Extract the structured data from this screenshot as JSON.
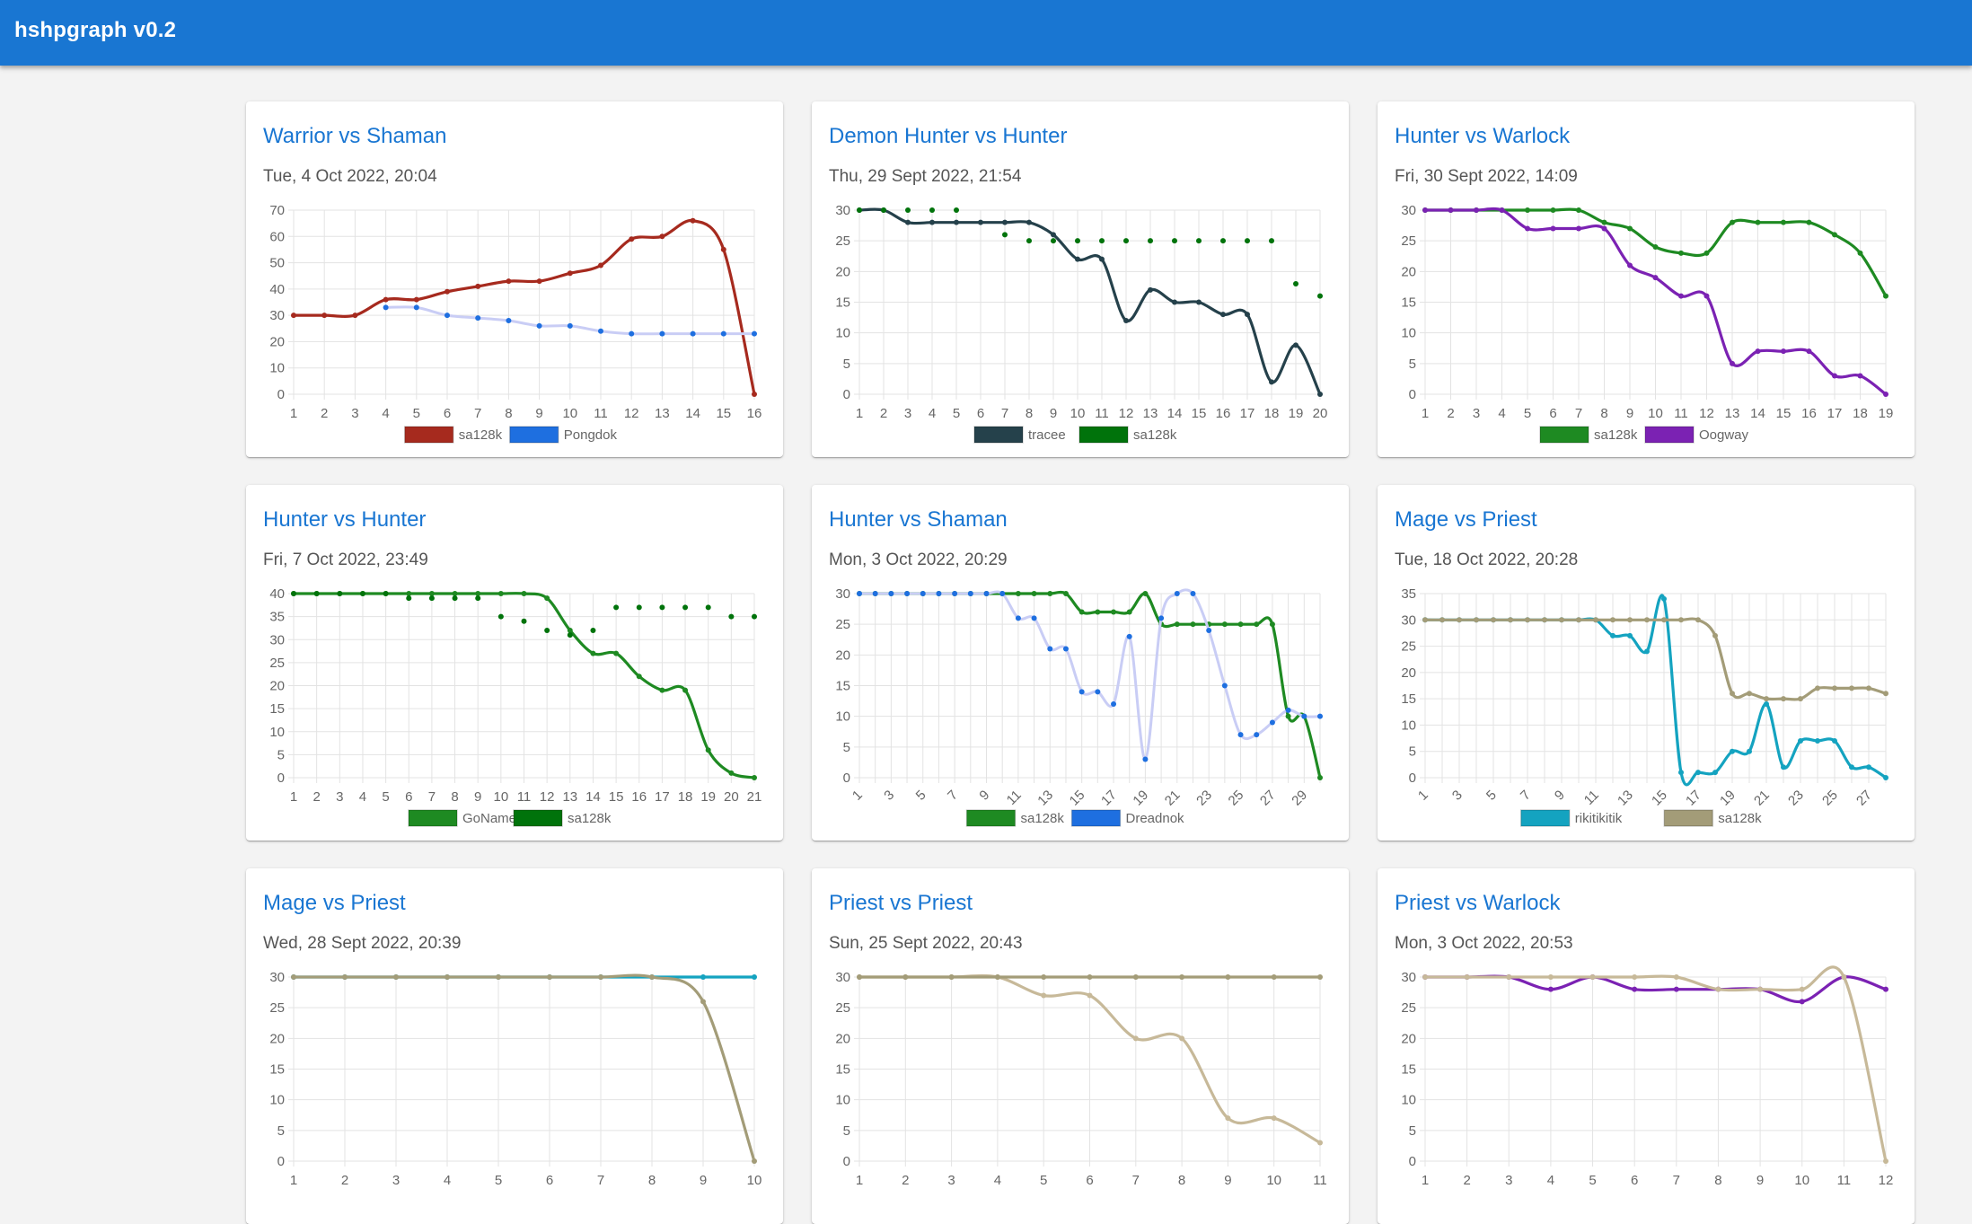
{
  "app": {
    "title": "hshpgraph v0.2"
  },
  "colors": {
    "appbar": "#1976d2",
    "title_link": "#1976d2"
  },
  "cards": [
    {
      "title": "Warrior vs Shaman",
      "date": "Tue, 4 Oct 2022, 20:04",
      "chart_data": {
        "type": "line",
        "x": [
          1,
          2,
          3,
          4,
          5,
          6,
          7,
          8,
          9,
          10,
          11,
          12,
          13,
          14,
          15,
          16
        ],
        "ylim": [
          0,
          70
        ],
        "yticks": [
          0,
          10,
          20,
          30,
          40,
          50,
          60,
          70
        ],
        "x_tick_style": "horizontal",
        "legend_position": "bottom",
        "grid": true,
        "series": [
          {
            "name": "sa128k",
            "color": "#a62a1e",
            "style": "line",
            "values": [
              30,
              30,
              30,
              36,
              36,
              39,
              41,
              43,
              43,
              46,
              49,
              59,
              60,
              66,
              55,
              0
            ]
          },
          {
            "name": "Pongdok",
            "color": "#1e6fe0",
            "line_color": "#c9cdf5",
            "style": "faint-line",
            "values": [
              null,
              null,
              null,
              33,
              33,
              30,
              29,
              28,
              26,
              26,
              24,
              23,
              23,
              23,
              23,
              23
            ]
          }
        ]
      }
    },
    {
      "title": "Demon Hunter vs Hunter",
      "date": "Thu, 29 Sept 2022, 21:54",
      "chart_data": {
        "type": "line",
        "x": [
          1,
          2,
          3,
          4,
          5,
          6,
          7,
          8,
          9,
          10,
          11,
          12,
          13,
          14,
          15,
          16,
          17,
          18,
          19,
          20
        ],
        "ylim": [
          0,
          30
        ],
        "yticks": [
          0,
          5,
          10,
          15,
          20,
          25,
          30
        ],
        "x_tick_style": "horizontal",
        "legend_position": "bottom",
        "grid": true,
        "series": [
          {
            "name": "tracee",
            "color": "#25414b",
            "style": "line",
            "values": [
              30,
              30,
              28,
              28,
              28,
              28,
              28,
              28,
              26,
              22,
              22,
              12,
              17,
              15,
              15,
              13,
              13,
              2,
              8,
              0
            ]
          },
          {
            "name": "sa128k",
            "color": "#00730b",
            "style": "points",
            "values": [
              30,
              30,
              30,
              30,
              30,
              null,
              26,
              25,
              25,
              25,
              25,
              25,
              25,
              25,
              25,
              25,
              25,
              25,
              18,
              16
            ]
          }
        ]
      }
    },
    {
      "title": "Hunter vs Warlock",
      "date": "Fri, 30 Sept 2022, 14:09",
      "chart_data": {
        "type": "line",
        "x": [
          1,
          2,
          3,
          4,
          5,
          6,
          7,
          8,
          9,
          10,
          11,
          12,
          13,
          14,
          15,
          16,
          17,
          18,
          19
        ],
        "ylim": [
          0,
          30
        ],
        "yticks": [
          0,
          5,
          10,
          15,
          20,
          25,
          30
        ],
        "x_tick_style": "horizontal",
        "legend_position": "bottom",
        "grid": true,
        "series": [
          {
            "name": "sa128k",
            "color": "#1e8a22",
            "style": "line",
            "values": [
              30,
              30,
              30,
              30,
              30,
              30,
              30,
              28,
              27,
              24,
              23,
              23,
              28,
              28,
              28,
              28,
              26,
              23,
              16
            ]
          },
          {
            "name": "Oogway",
            "color": "#7b22b3",
            "style": "line",
            "values": [
              30,
              30,
              30,
              30,
              27,
              27,
              27,
              27,
              21,
              19,
              16,
              16,
              5,
              7,
              7,
              7,
              3,
              3,
              0
            ]
          }
        ]
      }
    },
    {
      "title": "Hunter vs Hunter",
      "date": "Fri, 7 Oct 2022, 23:49",
      "chart_data": {
        "type": "line",
        "x": [
          1,
          2,
          3,
          4,
          5,
          6,
          7,
          8,
          9,
          10,
          11,
          12,
          13,
          14,
          15,
          16,
          17,
          18,
          19,
          20,
          21
        ],
        "ylim": [
          0,
          40
        ],
        "yticks": [
          0,
          5,
          10,
          15,
          20,
          25,
          30,
          35,
          40
        ],
        "x_tick_style": "horizontal",
        "legend_position": "bottom",
        "grid": true,
        "series": [
          {
            "name": "GoName",
            "color": "#1e8a22",
            "style": "line",
            "values": [
              40,
              40,
              40,
              40,
              40,
              40,
              40,
              40,
              40,
              40,
              40,
              39,
              32,
              27,
              27,
              22,
              19,
              19,
              6,
              1,
              0
            ]
          },
          {
            "name": "sa128k",
            "color": "#00730b",
            "style": "points",
            "values": [
              40,
              40,
              40,
              40,
              40,
              39,
              39,
              39,
              39,
              35,
              34,
              32,
              31,
              32,
              37,
              37,
              37,
              37,
              37,
              35,
              35
            ]
          }
        ]
      }
    },
    {
      "title": "Hunter vs Shaman",
      "date": "Mon, 3 Oct 2022, 20:29",
      "chart_data": {
        "type": "line",
        "x": [
          1,
          2,
          3,
          4,
          5,
          6,
          7,
          8,
          9,
          10,
          11,
          12,
          13,
          14,
          15,
          16,
          17,
          18,
          19,
          20,
          21,
          22,
          23,
          24,
          25,
          26,
          27,
          28,
          29,
          30
        ],
        "x_tick_labels": [
          1,
          null,
          3,
          null,
          5,
          null,
          7,
          null,
          9,
          null,
          11,
          null,
          13,
          null,
          15,
          null,
          17,
          null,
          19,
          null,
          21,
          null,
          23,
          null,
          25,
          null,
          27,
          null,
          29,
          null
        ],
        "ylim": [
          0,
          30
        ],
        "yticks": [
          0,
          5,
          10,
          15,
          20,
          25,
          30
        ],
        "x_tick_style": "rotated",
        "legend_position": "bottom",
        "grid": true,
        "series": [
          {
            "name": "sa128k",
            "color": "#1e8a22",
            "style": "line",
            "values": [
              30,
              30,
              30,
              30,
              30,
              30,
              30,
              30,
              30,
              30,
              30,
              30,
              30,
              30,
              27,
              27,
              27,
              27,
              30,
              25,
              25,
              25,
              25,
              25,
              25,
              25,
              25,
              10,
              10,
              0
            ]
          },
          {
            "name": "Dreadnok",
            "color": "#1e6fe0",
            "line_color": "#c9cdf5",
            "style": "faint-line",
            "values": [
              30,
              30,
              30,
              30,
              30,
              30,
              30,
              30,
              30,
              30,
              26,
              26,
              21,
              21,
              14,
              14,
              12,
              23,
              3,
              26,
              30,
              30,
              24,
              15,
              7,
              7,
              9,
              11,
              10,
              10
            ]
          }
        ]
      }
    },
    {
      "title": "Mage vs Priest",
      "date": "Tue, 18 Oct 2022, 20:28",
      "chart_data": {
        "type": "line",
        "x": [
          1,
          2,
          3,
          4,
          5,
          6,
          7,
          8,
          9,
          10,
          11,
          12,
          13,
          14,
          15,
          16,
          17,
          18,
          19,
          20,
          21,
          22,
          23,
          24,
          25,
          26,
          27,
          28
        ],
        "x_tick_labels": [
          1,
          null,
          3,
          null,
          5,
          null,
          7,
          null,
          9,
          null,
          11,
          null,
          13,
          null,
          15,
          null,
          17,
          null,
          19,
          null,
          21,
          null,
          23,
          null,
          25,
          null,
          27,
          null
        ],
        "ylim": [
          0,
          35
        ],
        "yticks": [
          0,
          5,
          10,
          15,
          20,
          25,
          30,
          35
        ],
        "x_tick_style": "rotated",
        "legend_position": "bottom",
        "grid": true,
        "series": [
          {
            "name": "rikitikitik",
            "color": "#14a3c0",
            "style": "line",
            "values": [
              30,
              30,
              30,
              30,
              30,
              30,
              30,
              30,
              30,
              30,
              30,
              27,
              27,
              24,
              34,
              1,
              1,
              1,
              5,
              5,
              14,
              2,
              7,
              7,
              7,
              2,
              2,
              0
            ]
          },
          {
            "name": "sa128k",
            "color": "#a39c78",
            "style": "line",
            "values": [
              30,
              30,
              30,
              30,
              30,
              30,
              30,
              30,
              30,
              30,
              30,
              30,
              30,
              30,
              30,
              30,
              30,
              27,
              16,
              16,
              15,
              15,
              15,
              17,
              17,
              17,
              17,
              16
            ]
          }
        ]
      }
    },
    {
      "title": "Mage vs Priest",
      "date": "Wed, 28 Sept 2022, 20:39",
      "chart_data": {
        "type": "line",
        "x": [
          1,
          2,
          3,
          4,
          5,
          6,
          7,
          8,
          9,
          10
        ],
        "ylim": [
          0,
          30
        ],
        "yticks": [
          0,
          5,
          10,
          15,
          20,
          25,
          30
        ],
        "x_tick_style": "horizontal",
        "legend_position": "bottom",
        "grid": true,
        "series": [
          {
            "name": "",
            "color": "#14a3c0",
            "style": "line",
            "values": [
              30,
              30,
              30,
              30,
              30,
              30,
              30,
              30,
              30,
              30
            ]
          },
          {
            "name": "",
            "color": "#a39c78",
            "style": "line",
            "values": [
              30,
              30,
              30,
              30,
              30,
              30,
              30,
              30,
              26,
              0
            ]
          }
        ]
      }
    },
    {
      "title": "Priest vs Priest",
      "date": "Sun, 25 Sept 2022, 20:43",
      "chart_data": {
        "type": "line",
        "x": [
          1,
          2,
          3,
          4,
          5,
          6,
          7,
          8,
          9,
          10,
          11
        ],
        "ylim": [
          0,
          30
        ],
        "yticks": [
          0,
          5,
          10,
          15,
          20,
          25,
          30
        ],
        "x_tick_style": "horizontal",
        "legend_position": "bottom",
        "grid": true,
        "series": [
          {
            "name": "",
            "color": "#c7b999",
            "style": "line",
            "values": [
              30,
              30,
              30,
              30,
              27,
              27,
              20,
              20,
              7,
              7,
              3
            ]
          },
          {
            "name": "",
            "color": "#a39c78",
            "style": "line",
            "values": [
              30,
              30,
              30,
              30,
              30,
              30,
              30,
              30,
              30,
              30,
              30
            ]
          }
        ]
      }
    },
    {
      "title": "Priest vs Warlock",
      "date": "Mon, 3 Oct 2022, 20:53",
      "chart_data": {
        "type": "line",
        "x": [
          1,
          2,
          3,
          4,
          5,
          6,
          7,
          8,
          9,
          10,
          11,
          12
        ],
        "ylim": [
          0,
          30
        ],
        "yticks": [
          0,
          5,
          10,
          15,
          20,
          25,
          30
        ],
        "x_tick_style": "horizontal",
        "legend_position": "bottom",
        "grid": true,
        "series": [
          {
            "name": "",
            "color": "#7b22b3",
            "style": "line",
            "values": [
              30,
              30,
              30,
              28,
              30,
              28,
              28,
              28,
              28,
              26,
              30,
              28
            ]
          },
          {
            "name": "",
            "color": "#c7b999",
            "style": "line",
            "values": [
              30,
              30,
              30,
              30,
              30,
              30,
              30,
              28,
              28,
              28,
              30,
              0
            ]
          }
        ]
      }
    }
  ]
}
